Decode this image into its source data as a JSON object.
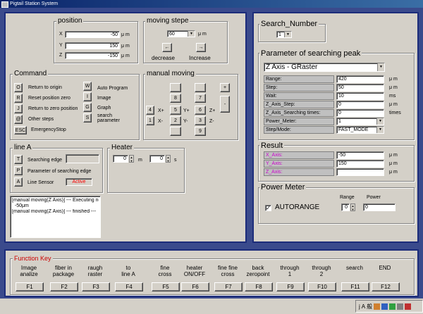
{
  "window": {
    "title": "Pigtail Station System"
  },
  "position": {
    "title": "position",
    "axes": [
      {
        "label": "X",
        "value": "-50",
        "unit": "μ m"
      },
      {
        "label": "Y",
        "value": "150",
        "unit": "μ m"
      },
      {
        "label": "Z",
        "value": "-150",
        "unit": "μ m"
      }
    ]
  },
  "moving_steps": {
    "title": "moving  stepe",
    "value": "60",
    "unit": "μ m",
    "decrease": "decrease",
    "increase": "Increase",
    "left_arrow": "←",
    "right_arrow": "→"
  },
  "command": {
    "title": "Command",
    "items": [
      {
        "key": "O",
        "label": "Return to origin"
      },
      {
        "key": "R",
        "label": "Reset position zero"
      },
      {
        "key": "J",
        "label": "Return to zero position"
      },
      {
        "key": "@",
        "label": "Other steps"
      }
    ],
    "right_items": [
      {
        "key": "W",
        "label": "Auto Program"
      },
      {
        "key": "I",
        "label": "Image"
      },
      {
        "key": "G",
        "label": "Graph"
      },
      {
        "key": "S",
        "label": "search parameter"
      }
    ],
    "esc": {
      "key": "ESC",
      "label": "EmergencyStop"
    }
  },
  "manual_moving": {
    "title": "manual moving",
    "keys": [
      "4",
      "1",
      "8",
      "2",
      "6",
      "3",
      "7",
      "9",
      "5"
    ],
    "labels": {
      "xp": "X+",
      "xm": "X-",
      "yp": "Y+",
      "ym": "Y-",
      "zp": "Z+",
      "zm": "Z-"
    },
    "plus": "+",
    "minus": "-"
  },
  "line_a": {
    "title": "line A",
    "items": [
      {
        "key": "T",
        "label": "Searching edge"
      },
      {
        "key": "P",
        "label": "Parameter of searching edge"
      },
      {
        "key": "A",
        "label": "Line Sensor"
      }
    ],
    "status": "Active",
    "status_color": "#ff0000"
  },
  "heater": {
    "title": "Heater",
    "minutes": "0",
    "m_unit": "m",
    "seconds": "0",
    "s_unit": "s"
  },
  "log": {
    "lines": [
      "[manual moving(Z Axis)] --- Executing  now. ---",
      "  -50μm",
      "[manual moving(Z Axis)] --- finished ---"
    ]
  },
  "search_number": {
    "title": "Search_Number",
    "value": "1"
  },
  "peak": {
    "title": "Parameter of searching peak",
    "mode": "Z Axis - GRaster",
    "rows": [
      {
        "label": "Range:",
        "value": "420",
        "unit": "μ m"
      },
      {
        "label": "Step:",
        "value": "50",
        "unit": "μ m"
      },
      {
        "label": "Wait:",
        "value": "10",
        "unit": "ms"
      },
      {
        "label": "Z_Axis_Step:",
        "value": "0",
        "unit": "μ m"
      },
      {
        "label": "Z_Axis_Searching times:",
        "value": "0",
        "unit": "times"
      },
      {
        "label": "Power_Meter:",
        "value": "1",
        "unit": ""
      },
      {
        "label": "Step/Mode:",
        "value": "FAST_MODE",
        "unit": ""
      }
    ]
  },
  "result": {
    "title": "Result",
    "rows": [
      {
        "label": "X_Axis:",
        "value": "-50",
        "unit": "μ m"
      },
      {
        "label": "Y_Axis:",
        "value": "150",
        "unit": "μ m"
      },
      {
        "label": "Z_Axis:",
        "value": "",
        "unit": "μ m"
      }
    ],
    "label_color": "#cc00cc"
  },
  "power_meter": {
    "title": "Power Meter",
    "autorange": "AUTORANGE",
    "range_label": "Range",
    "range_value": "0",
    "power_label": "Power",
    "power_value": "0",
    "check": "✓"
  },
  "function_key": {
    "title": "Function Key",
    "title_color": "#cc0000",
    "keys": [
      {
        "desc": "Image\nanalize",
        "key": "F1"
      },
      {
        "desc": "fiber in\npackage",
        "key": "F2"
      },
      {
        "desc": "raugh\nraster",
        "key": "F3"
      },
      {
        "desc": "to\nline A",
        "key": "F4"
      },
      {
        "desc": "fine\ncross",
        "key": "F5"
      },
      {
        "desc": "heater\nON/OFF",
        "key": "F6"
      },
      {
        "desc": "fine fine\ncross",
        "key": "F7"
      },
      {
        "desc": "back\nzeropoint",
        "key": "F8"
      },
      {
        "desc": "through\n1",
        "key": "F9"
      },
      {
        "desc": "through\n2",
        "key": "F10"
      },
      {
        "desc": "search",
        "key": "F11"
      },
      {
        "desc": "END",
        "key": "F12"
      }
    ]
  },
  "taskbar": {
    "ime": "j",
    "ime2": "A",
    "ime3": "般"
  }
}
